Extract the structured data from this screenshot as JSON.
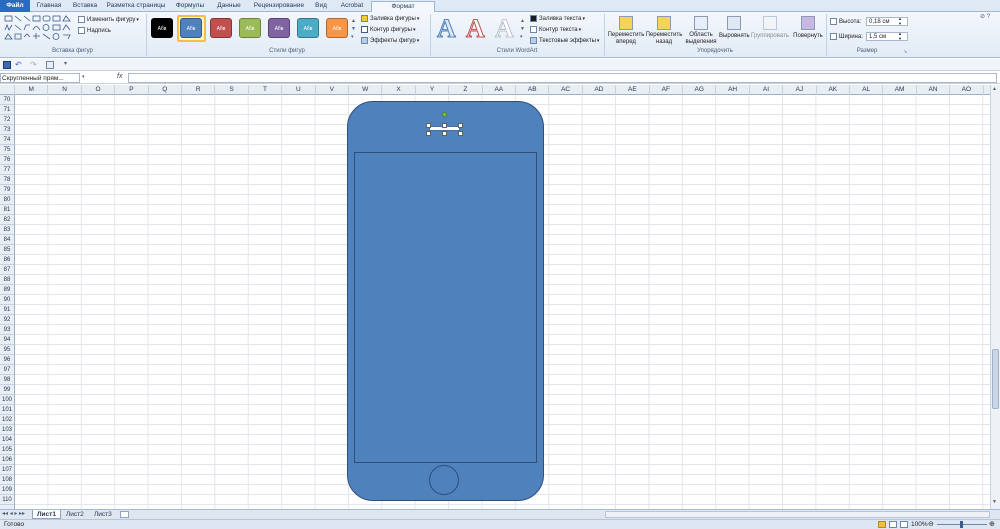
{
  "tabs": [
    "Файл",
    "Главная",
    "Вставка",
    "Разметка страницы",
    "Формулы",
    "Данные",
    "Рецензирование",
    "Вид",
    "Acrobat",
    "Формат"
  ],
  "ribbon": {
    "insert_shapes": {
      "change_shape": "Изменить фигуру",
      "text_box": "Надпись",
      "label": "Вставка фигур"
    },
    "shape_styles": {
      "swatch_text": "Абв",
      "fill": "Заливка фигуры",
      "outline": "Контур фигуры",
      "effects": "Эффекты фигур",
      "label": "Стили фигур"
    },
    "wordart": {
      "glyph": "A",
      "text_fill": "Заливка текста",
      "text_outline": "Контур текста",
      "text_effects": "Текстовые эффекты",
      "label": "Стили WordArt"
    },
    "arrange": {
      "forward": "Переместить вперед",
      "backward": "Переместить назад",
      "selection": "Область выделения",
      "align": "Выровнять",
      "group": "Группировать",
      "rotate": "Повернуть",
      "label": "Упорядочить"
    },
    "size": {
      "height_label": "Высота:",
      "height_value": "0,18 см",
      "width_label": "Ширина:",
      "width_value": "1,5 см",
      "label": "Размер"
    }
  },
  "swatch_colors": [
    "#000000",
    "#4f81bd",
    "#c0504d",
    "#9bbb59",
    "#8064a2",
    "#4bacc6",
    "#f79646"
  ],
  "formula_bar": {
    "name_box": "Скругленный прям...",
    "fx": "fx"
  },
  "columns": [
    "M",
    "N",
    "O",
    "P",
    "Q",
    "R",
    "S",
    "T",
    "U",
    "V",
    "W",
    "X",
    "Y",
    "Z",
    "AA",
    "AB",
    "AC",
    "AD",
    "AE",
    "AF",
    "AG",
    "AH",
    "AI",
    "AJ",
    "AK",
    "AL",
    "AM",
    "AN",
    "AO"
  ],
  "rows": [
    "70",
    "71",
    "72",
    "73",
    "74",
    "75",
    "76",
    "77",
    "78",
    "79",
    "80",
    "81",
    "82",
    "83",
    "84",
    "85",
    "86",
    "87",
    "88",
    "89",
    "90",
    "91",
    "92",
    "93",
    "94",
    "95",
    "96",
    "97",
    "98",
    "99",
    "100",
    "101",
    "102",
    "103",
    "104",
    "105",
    "106",
    "107",
    "108",
    "109",
    "110"
  ],
  "sheets": [
    "Лист1",
    "Лист2",
    "Лист3"
  ],
  "status": {
    "ready": "Готово",
    "zoom": "100%"
  }
}
